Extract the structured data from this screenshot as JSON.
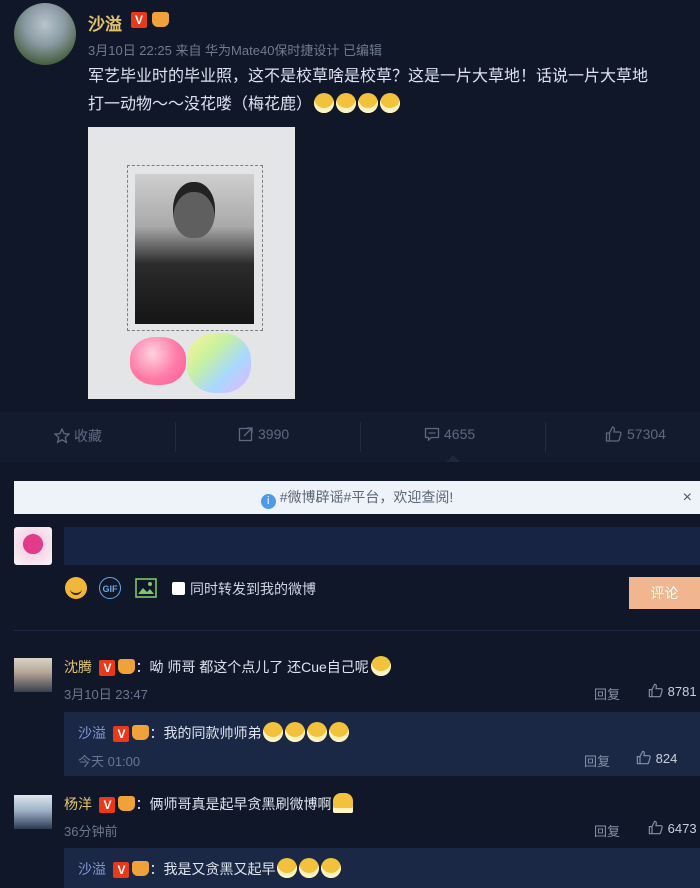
{
  "post": {
    "username": "沙溢",
    "verified_badge": "V",
    "meta": "3月10日 22:25 来自 华为Mate40保时捷设计  已编辑",
    "text_line1": "军艺毕业时的毕业照，这不是校草啥是校草？这是一片大草地！话说一片大草地",
    "text_line2": "打一动物～～没花喽（梅花鹿）"
  },
  "actions": {
    "favorite": "收藏",
    "repost_count": "3990",
    "comment_count": "4655",
    "like_count": "57304"
  },
  "notice": {
    "text": "#微博辟谣#平台，欢迎查阅!",
    "close": "×"
  },
  "composer": {
    "also_repost_label": "同时转发到我的微博",
    "submit_label": "评论",
    "gif_label": "GIF"
  },
  "comments": [
    {
      "name": "沈腾",
      "text": "：呦 师哥 都这个点儿了 还Cue自己呢",
      "time": "3月10日 23:47",
      "reply_label": "回复",
      "likes": "8781",
      "reply": {
        "name": "沙溢",
        "text": "：我的同款帅师弟",
        "time": "今天 01:00",
        "reply_label": "回复",
        "likes": "824"
      }
    },
    {
      "name": "杨洋",
      "text": "：俩师哥真是起早贪黑刷微博啊",
      "time": "36分钟前",
      "reply_label": "回复",
      "likes": "6473",
      "reply": {
        "name": "沙溢",
        "text": "：我是又贪黑又起早"
      }
    }
  ],
  "colors": {
    "background": "#101729",
    "username": "#e0c36a",
    "reply_name": "#7f9ad6",
    "submit": "#f1b690"
  }
}
